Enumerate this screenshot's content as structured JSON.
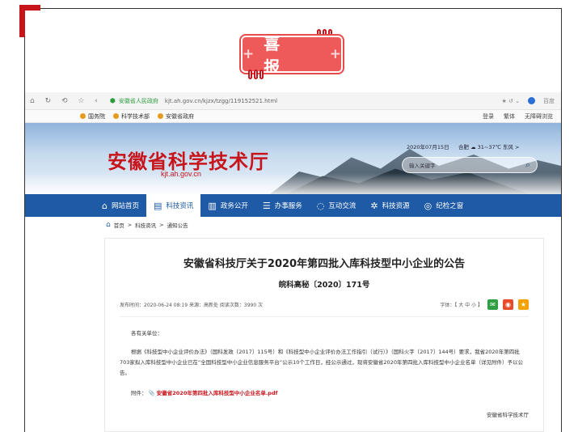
{
  "badge": {
    "text": "喜 报",
    "left_plus": "+",
    "right_plus": "+"
  },
  "browser": {
    "nav_buttons": "⌂ ↻ ⟲ ☆ ‹",
    "site_name": "安徽省人民政府",
    "url": "kjt.ah.gov.cn/kjzx/tzgg/119152521.html",
    "search_engine": "百度"
  },
  "bookmarks": {
    "items": [
      "国务院",
      "科学技术部",
      "安徽省政府"
    ],
    "right": [
      "登录",
      "繁体",
      "无障碍浏览"
    ]
  },
  "banner": {
    "title": "安徽省科学技术厅",
    "domain": "kjt.ah.gov.cn",
    "date": "2020年07月15日",
    "weather": "合肥 ☁ 31~37℃ 东风 >",
    "search_placeholder": "输入关键字"
  },
  "nav": {
    "items": [
      {
        "icon": "⌂",
        "label": "网站首页"
      },
      {
        "icon": "▤",
        "label": "科技资讯"
      },
      {
        "icon": "▥",
        "label": "政务公开"
      },
      {
        "icon": "☰",
        "label": "办事服务"
      },
      {
        "icon": "◌",
        "label": "互动交流"
      },
      {
        "icon": "✲",
        "label": "科技资源"
      },
      {
        "icon": "◎",
        "label": "纪检之窗"
      }
    ]
  },
  "breadcrumb": {
    "home": "首页",
    "sep1": ">",
    "level1": "科技资讯",
    "sep2": ">",
    "level2": "通知公告"
  },
  "article": {
    "title": "安徽省科技厅关于2020年第四批入库科技型中小企业的公告",
    "doc_no": "皖科高秘〔2020〕171号",
    "meta": "发布时间：2020-06-24 08:19    来源：高新处    阅读次数：3990 次",
    "font_size": "字体：【 大 中 小 】",
    "greeting": "各有关单位：",
    "paragraph": "根据《科技型中小企业评价办法》（国科发政〔2017〕115号）和《科技型中小企业评价办法工作指引（试行）》（国科火字〔2017〕144号）要求，我省2020年第四批703家拟入库科技型中小企业已在“全国科技型中小企业信息服务平台”公示10个工作日，经公示通过，现将安徽省2020年第四批入库科技型中小企业名单（详见附件）予以公告。",
    "attachment_label": "附件：",
    "attachment_link": "安徽省2020年第四批入库科技型中小企业名单.pdf",
    "signature": "安徽省科学技术厅"
  }
}
